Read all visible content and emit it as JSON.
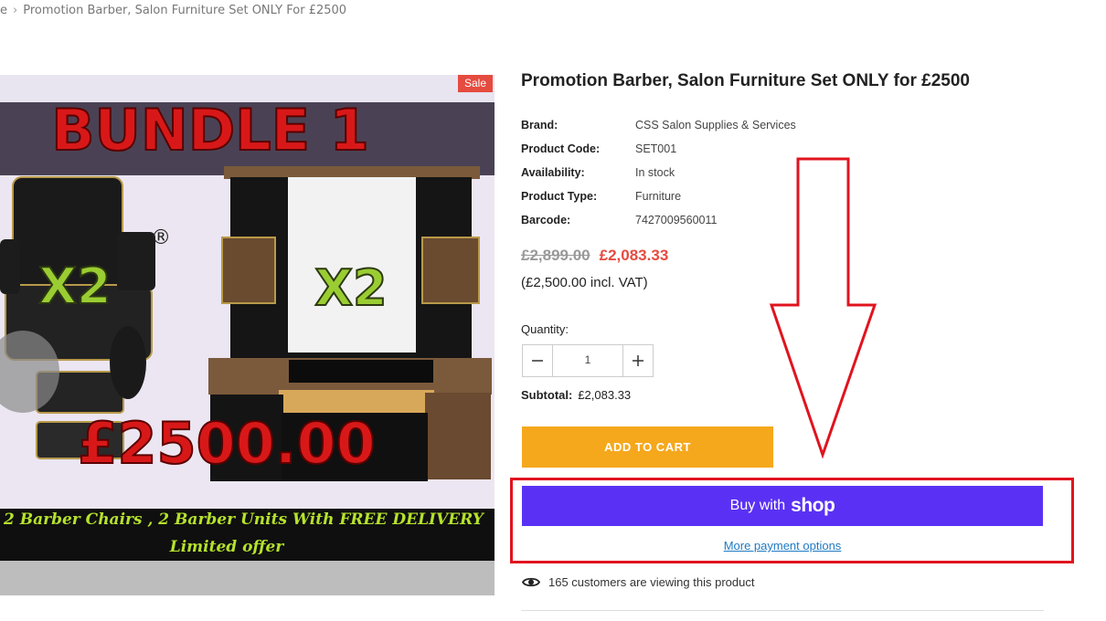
{
  "breadcrumb": {
    "home": "e",
    "separator": "›",
    "current": "Promotion Barber, Salon Furniture Set ONLY For £2500"
  },
  "image": {
    "sale_badge": "Sale",
    "headline": "BUNDLE 1",
    "multiplier_left": "X2",
    "multiplier_right": "X2",
    "registered_mark": "®",
    "price_text": "£2500.00",
    "banner_line1": "2 Barber Chairs , 2 Barber Units With FREE DELIVERY",
    "banner_line2": "Limited offer"
  },
  "product": {
    "title": "Promotion Barber, Salon Furniture Set ONLY for £2500",
    "specs": [
      {
        "label": "Brand:",
        "value": "CSS Salon Supplies & Services"
      },
      {
        "label": "Product Code:",
        "value": "SET001"
      },
      {
        "label": "Availability:",
        "value": "In stock"
      },
      {
        "label": "Product Type:",
        "value": "Furniture"
      },
      {
        "label": "Barcode:",
        "value": "7427009560011"
      }
    ],
    "price_old": "£2,899.00",
    "price_new": "£2,083.33",
    "price_vat": "(£2,500.00 incl. VAT)"
  },
  "quantity": {
    "label": "Quantity:",
    "value": "1",
    "minus_icon": "minus-icon",
    "plus_icon": "plus-icon"
  },
  "subtotal": {
    "label": "Subtotal:",
    "value": "£2,083.33"
  },
  "actions": {
    "add_to_cart": "ADD TO CART",
    "buy_with": "Buy with",
    "shop_logo": "shop",
    "more_payment_options": "More payment options"
  },
  "viewers": {
    "icon": "eye-icon",
    "text": "165 customers are viewing this product"
  },
  "colors": {
    "sale": "#e54b3f",
    "add_to_cart": "#f5a81c",
    "shop_pay": "#5a31f4",
    "annotation_red": "#e0141f",
    "link": "#1f7ac4"
  }
}
